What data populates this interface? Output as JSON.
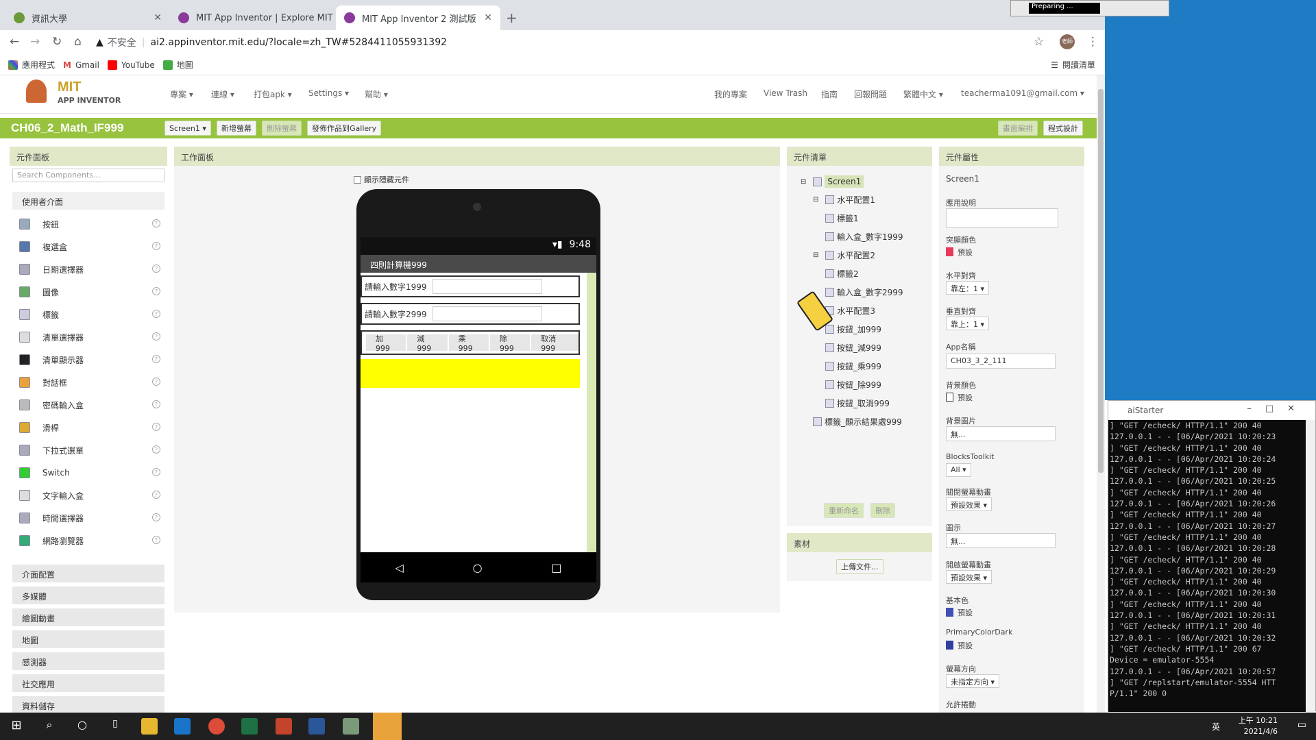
{
  "browser": {
    "tabs": [
      {
        "label": "資訊大學",
        "fav": "#6a9a3a"
      },
      {
        "label": "MIT App Inventor | Explore MIT",
        "fav": "#8a3a9a"
      },
      {
        "label": "MIT App Inventor 2 測試版",
        "fav": "#8a3a9a"
      }
    ],
    "security": "不安全",
    "url": "ai2.appinventor.mit.edu/?locale=zh_TW#5284411055931392",
    "bookmarks": [
      "應用程式",
      "Gmail",
      "YouTube",
      "地圖"
    ],
    "reading_list": "閱讀清單",
    "profile": "老師",
    "recorder": "Preparing ..."
  },
  "app": {
    "logo_top": "MIT",
    "logo_bottom": "APP INVENTOR",
    "menu_left": [
      "專案 ▾",
      "連線 ▾",
      "打包apk ▾",
      "Settings ▾",
      "幫助 ▾"
    ],
    "menu_right": [
      "我的專案",
      "View Trash",
      "指南",
      "回報問題",
      "繁體中文 ▾",
      "teacherma1091@gmail.com ▾"
    ],
    "project": "CH06_2_Math_IF999",
    "screen_dd": "Screen1 ▾",
    "add_screen": "新增螢幕",
    "remove_screen": "刪除螢幕",
    "publish": "發佈作品到Gallery",
    "designer": "畫面編排",
    "blocks": "程式設計"
  },
  "palette": {
    "title": "元件面板",
    "search": "Search Components...",
    "category": "使用者介面",
    "items": [
      "按鈕",
      "複選盒",
      "日期選擇器",
      "圖像",
      "標籤",
      "清單選擇器",
      "清單顯示器",
      "對話框",
      "密碼輸入盒",
      "滑桿",
      "下拉式選單",
      "Switch",
      "文字輸入盒",
      "時間選擇器",
      "網路瀏覽器"
    ],
    "categories": [
      "介面配置",
      "多媒體",
      "繪圖動畫",
      "地圖",
      "感測器",
      "社交應用",
      "資料儲存"
    ]
  },
  "viewer": {
    "title": "工作面板",
    "show_hidden": "顯示隱藏元件",
    "time": "9:48",
    "app_title": "四則計算機999",
    "label1": "請輸入數字1999",
    "label2": "請輸入數字2999",
    "buttons": [
      "加999",
      "減999",
      "乘999",
      "除999",
      "取消999"
    ]
  },
  "tree": {
    "title": "元件清單",
    "nodes": [
      "Screen1",
      "水平配置1",
      "標籤1",
      "輸入盒_數字1999",
      "水平配置2",
      "標籤2",
      "輸入盒_數字2999",
      "水平配置3",
      "按鈕_加999",
      "按鈕_減999",
      "按鈕_乘999",
      "按鈕_除999",
      "按鈕_取消999",
      "標籤_顯示結果處999"
    ],
    "rename": "重新命名",
    "delete": "刪除"
  },
  "media": {
    "title": "素材",
    "upload": "上傳文件..."
  },
  "props": {
    "title": "元件屬性",
    "component": "Screen1",
    "about": "應用說明",
    "accent": "突顯顏色",
    "accent_val": "預設",
    "halign": "水平對齊",
    "halign_val": "靠左：1 ▾",
    "valign": "垂直對齊",
    "valign_val": "靠上：1 ▾",
    "appname": "App名稱",
    "appname_val": "CH03_3_2_111",
    "bgcolor": "背景顏色",
    "bgcolor_val": "預設",
    "bgimg": "背景圖片",
    "bgimg_val": "無...",
    "blocks": "BlocksToolkit",
    "blocks_val": "All ▾",
    "close_anim": "關閉螢幕動畫",
    "close_anim_val": "預設效果 ▾",
    "icon": "圖示",
    "icon_val": "無...",
    "open_anim": "開啟螢幕動畫",
    "open_anim_val": "預設效果 ▾",
    "primary": "基本色",
    "primary_val": "預設",
    "primary_dark": "PrimaryColorDark",
    "primary_dark_val": "預設",
    "orient": "螢幕方向",
    "orient_val": "未指定方向 ▾",
    "scroll": "允許捲動"
  },
  "aistarter": {
    "title": "aiStarter",
    "lines": [
      "] \"GET /echeck/ HTTP/1.1\" 200 40",
      "127.0.0.1 - - [06/Apr/2021 10:20:23",
      "] \"GET /echeck/ HTTP/1.1\" 200 40",
      "127.0.0.1 - - [06/Apr/2021 10:20:24",
      "] \"GET /echeck/ HTTP/1.1\" 200 40",
      "127.0.0.1 - - [06/Apr/2021 10:20:25",
      "] \"GET /echeck/ HTTP/1.1\" 200 40",
      "127.0.0.1 - - [06/Apr/2021 10:20:26",
      "] \"GET /echeck/ HTTP/1.1\" 200 40",
      "127.0.0.1 - - [06/Apr/2021 10:20:27",
      "] \"GET /echeck/ HTTP/1.1\" 200 40",
      "127.0.0.1 - - [06/Apr/2021 10:20:28",
      "] \"GET /echeck/ HTTP/1.1\" 200 40",
      "127.0.0.1 - - [06/Apr/2021 10:20:29",
      "] \"GET /echeck/ HTTP/1.1\" 200 40",
      "127.0.0.1 - - [06/Apr/2021 10:20:30",
      "] \"GET /echeck/ HTTP/1.1\" 200 40",
      "127.0.0.1 - - [06/Apr/2021 10:20:31",
      "] \"GET /echeck/ HTTP/1.1\" 200 40",
      "127.0.0.1 - - [06/Apr/2021 10:20:32",
      "] \"GET /echeck/ HTTP/1.1\" 200 67",
      "Device = emulator-5554",
      "127.0.0.1 - - [06/Apr/2021 10:20:57",
      "] \"GET /replstart/emulator-5554 HTT",
      "P/1.1\" 200 0"
    ]
  },
  "taskbar": {
    "time": "上午 10:21",
    "date": "2021/4/6",
    "ime": "英"
  },
  "colors": {
    "accent": "#e8375a",
    "brand": "#97c33e",
    "primary": "#3f51b5",
    "highlight": "#ffff00"
  }
}
